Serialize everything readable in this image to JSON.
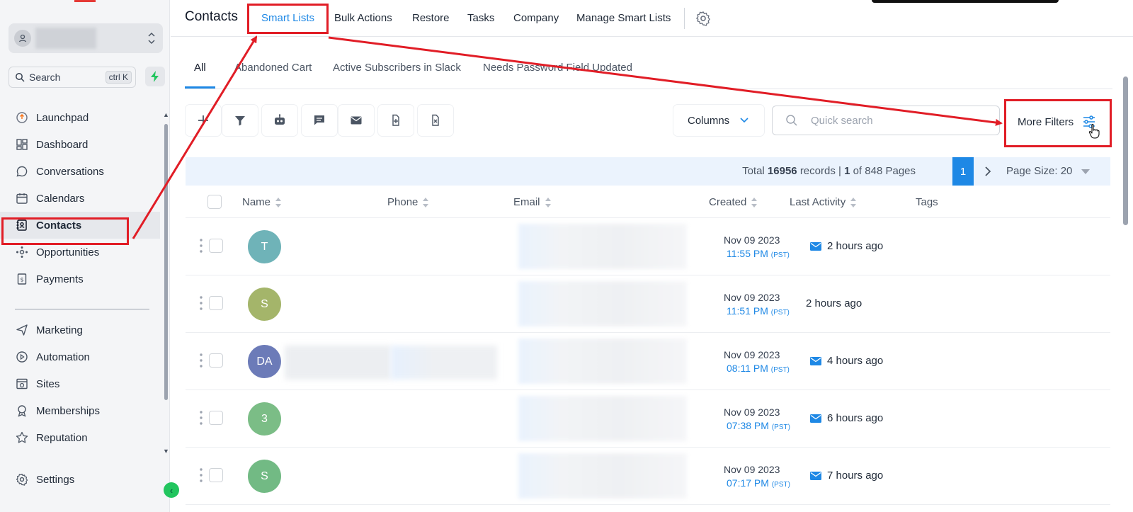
{
  "sidebar": {
    "search_placeholder": "Search",
    "search_shortcut": "ctrl K",
    "items": [
      {
        "label": "Launchpad"
      },
      {
        "label": "Dashboard"
      },
      {
        "label": "Conversations"
      },
      {
        "label": "Calendars"
      },
      {
        "label": "Contacts"
      },
      {
        "label": "Opportunities"
      },
      {
        "label": "Payments"
      },
      {
        "label": "Marketing"
      },
      {
        "label": "Automation"
      },
      {
        "label": "Sites"
      },
      {
        "label": "Memberships"
      },
      {
        "label": "Reputation"
      },
      {
        "label": "Settings"
      }
    ]
  },
  "header": {
    "title": "Contacts",
    "tabs": [
      {
        "label": "Smart Lists"
      },
      {
        "label": "Bulk Actions"
      },
      {
        "label": "Restore"
      },
      {
        "label": "Tasks"
      },
      {
        "label": "Company"
      },
      {
        "label": "Manage Smart Lists"
      }
    ]
  },
  "smart_lists": [
    {
      "label": "All"
    },
    {
      "label": "Abandoned Cart"
    },
    {
      "label": "Active Subscribers in Slack"
    },
    {
      "label": "Needs Password Field Updated"
    }
  ],
  "toolbar": {
    "columns_label": "Columns",
    "quick_search_placeholder": "Quick search",
    "more_filters_label": "More Filters"
  },
  "summary": {
    "total_prefix": "Total",
    "total_records": "16956",
    "records_label": "records |",
    "current_page": "1",
    "of_pages": "of 848 Pages",
    "page_size": "Page Size: 20"
  },
  "table": {
    "columns": [
      "Name",
      "Phone",
      "Email",
      "Created",
      "Last Activity",
      "Tags"
    ],
    "rows": [
      {
        "initials": "T",
        "avatar_color": "#6fb3b8",
        "date": "Nov 09 2023",
        "time": "11:55 PM",
        "tz": "(PST)",
        "activity": "2 hours ago",
        "mail": true
      },
      {
        "initials": "S",
        "avatar_color": "#a4b56a",
        "date": "Nov 09 2023",
        "time": "11:51 PM",
        "tz": "(PST)",
        "activity": "2 hours ago",
        "mail": false
      },
      {
        "initials": "DA",
        "avatar_color": "#6c7bb8",
        "date": "Nov 09 2023",
        "time": "08:11 PM",
        "tz": "(PST)",
        "activity": "4 hours ago",
        "mail": true
      },
      {
        "initials": "3",
        "avatar_color": "#7bbd86",
        "date": "Nov 09 2023",
        "time": "07:38 PM",
        "tz": "(PST)",
        "activity": "6 hours ago",
        "mail": true
      },
      {
        "initials": "S",
        "avatar_color": "#72ba84",
        "date": "Nov 09 2023",
        "time": "07:17 PM",
        "tz": "(PST)",
        "activity": "7 hours ago",
        "mail": true
      }
    ]
  },
  "colors": {
    "accent": "#1e88e5",
    "annotation": "#e11d26"
  },
  "icons": {
    "sidebar": [
      "rocket-icon",
      "dashboard-icon",
      "chat-icon",
      "calendar-icon",
      "contacts-icon",
      "opportunities-icon",
      "payments-icon",
      "marketing-icon",
      "automation-icon",
      "sites-icon",
      "memberships-icon",
      "reputation-icon",
      "gear-icon"
    ],
    "toolbar": [
      "plus-icon",
      "filter-icon",
      "robot-icon",
      "message-icon",
      "mail-icon",
      "tag-add-icon",
      "tag-remove-icon"
    ]
  }
}
